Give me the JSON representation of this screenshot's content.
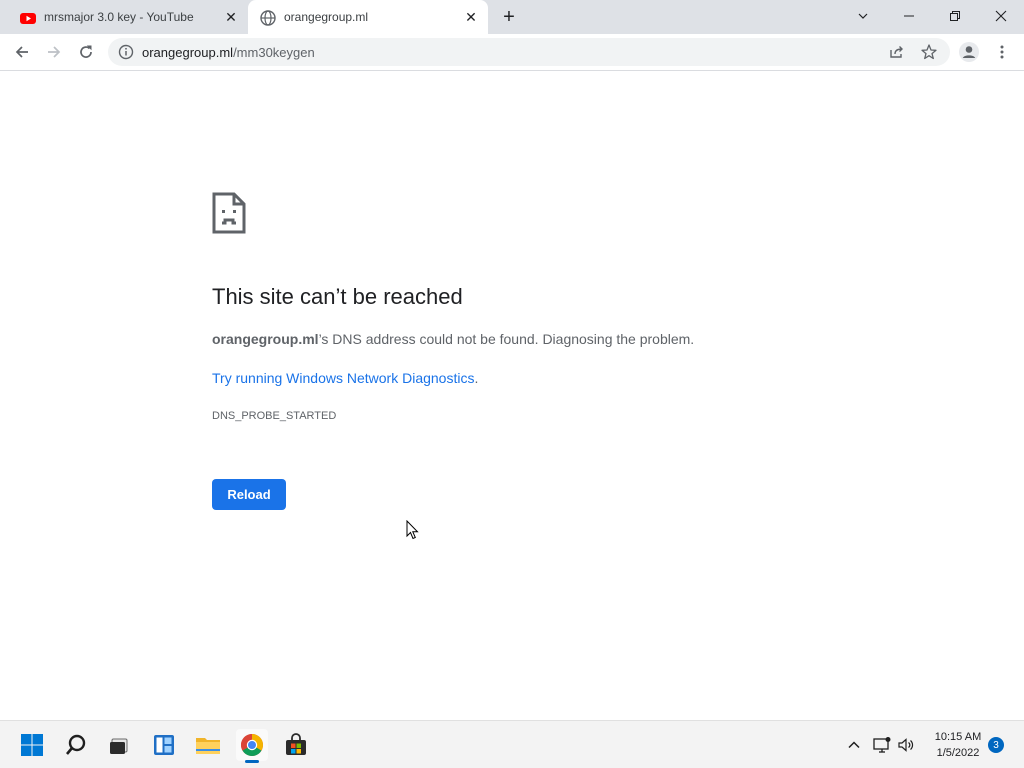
{
  "browser": {
    "tabs": [
      {
        "title": "mrsmajor 3.0 key - YouTube",
        "favicon": "youtube-icon",
        "active": false
      },
      {
        "title": "orangegroup.ml",
        "favicon": "globe-icon",
        "active": true
      }
    ],
    "new_tab_icon": "plus-icon",
    "window_controls": [
      "chevron-down-icon",
      "minimize-icon",
      "restore-icon",
      "close-icon"
    ],
    "address": {
      "host": "orangegroup.ml",
      "path": "/mm30keygen"
    }
  },
  "error_page": {
    "icon": "sad-page-icon",
    "title": "This site can’t be reached",
    "desc_host": "orangegroup.ml",
    "desc_rest": "’s DNS address could not be found. Diagnosing the problem.",
    "diag_link": "Try running Windows Network Diagnostics",
    "diag_period": ".",
    "error_code": "DNS_PROBE_STARTED",
    "reload_label": "Reload"
  },
  "taskbar": {
    "apps": [
      "windows-start-icon",
      "search-icon",
      "task-view-icon",
      "widgets-icon",
      "file-explorer-icon",
      "chrome-icon",
      "store-icon"
    ],
    "tray": [
      "chevron-up-icon",
      "network-icon",
      "volume-icon"
    ],
    "time": "10:15 AM",
    "date": "1/5/2022",
    "notifications": "3"
  },
  "colors": {
    "accent": "#1a73e8",
    "youtube_red": "#ff0000",
    "tabstrip_bg": "#dee1e6",
    "taskbar_bg": "#f3f3f3"
  }
}
